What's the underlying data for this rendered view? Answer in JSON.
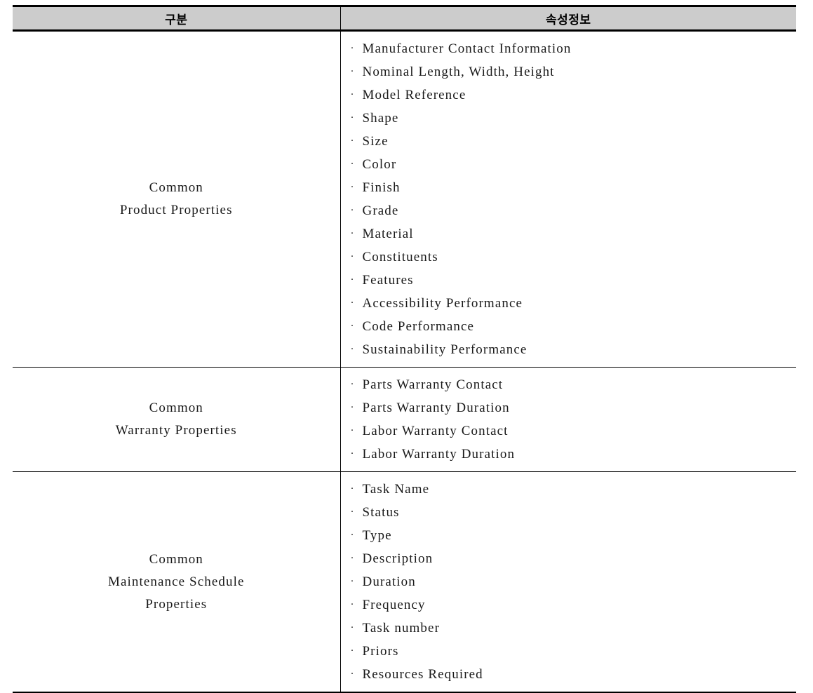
{
  "table": {
    "headers": {
      "category": "구분",
      "attributes": "속성정보"
    },
    "bullet_glyph": "·",
    "colors": {
      "header_fill": "#cccccc",
      "border": "#000000",
      "text": "#1a1a1a"
    },
    "sections": [
      {
        "category_lines": [
          "Common",
          "Product Properties"
        ],
        "attributes": [
          "Manufacturer Contact Information",
          "Nominal Length, Width, Height",
          "Model Reference",
          "Shape",
          "Size",
          "Color",
          "Finish",
          "Grade",
          "Material",
          "Constituents",
          "Features",
          "Accessibility Performance",
          "Code Performance",
          "Sustainability Performance"
        ]
      },
      {
        "category_lines": [
          "Common",
          "Warranty Properties"
        ],
        "attributes": [
          "Parts Warranty Contact",
          "Parts Warranty Duration",
          "Labor Warranty Contact",
          "Labor Warranty Duration"
        ]
      },
      {
        "category_lines": [
          "Common",
          "Maintenance Schedule",
          "Properties"
        ],
        "attributes": [
          "Task Name",
          "Status",
          "Type",
          "Description",
          "Duration",
          "Frequency",
          "Task number",
          "Priors",
          "Resources Required"
        ]
      }
    ]
  }
}
